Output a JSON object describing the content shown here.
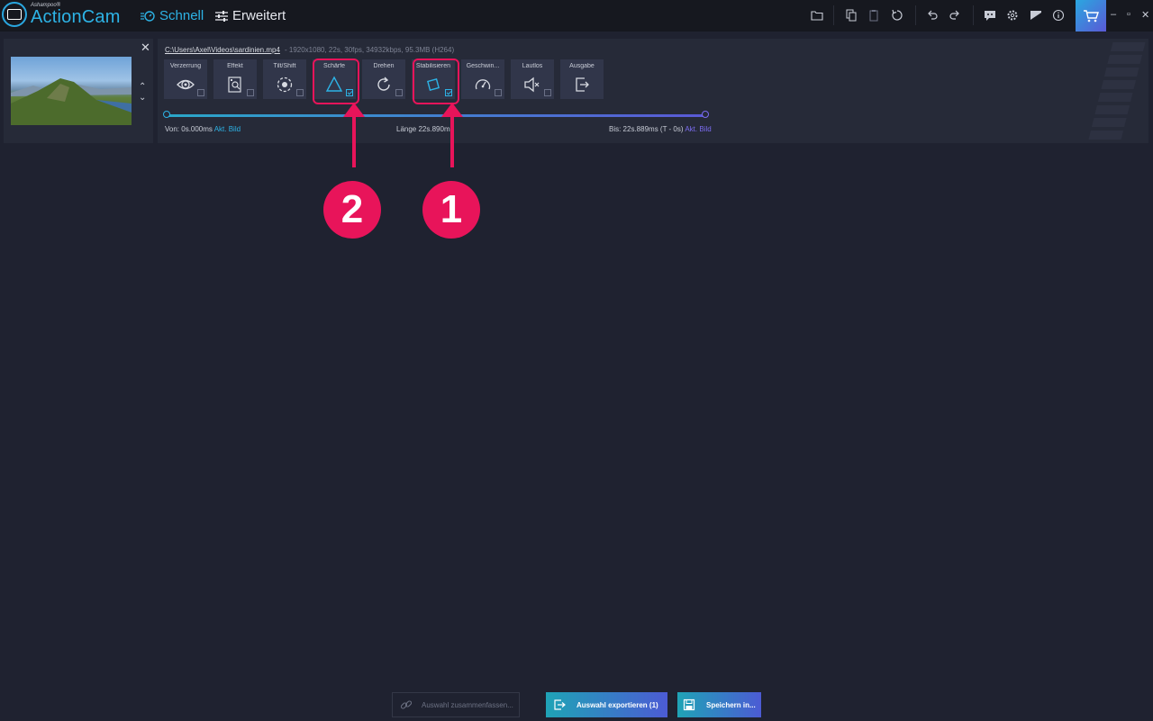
{
  "app": {
    "brand_small": "Ashampoo®",
    "brand": "ActionCam",
    "mode_quick": "Schnell",
    "mode_advanced": "Erweitert"
  },
  "toolbar_icons": [
    "folder-icon",
    "copy-icon",
    "clipboard-icon",
    "reset-icon",
    "undo-icon",
    "redo-icon",
    "feedback-icon",
    "settings-icon",
    "image-icon",
    "info-icon",
    "cart-icon"
  ],
  "window_controls": [
    "–",
    "▫",
    "✕"
  ],
  "item": {
    "file_path": "C:\\Users\\Axel\\Videos\\sardinien.mp4",
    "file_info": "-   1920x1080, 22s, 30fps, 34932kbps, 95.3MB (H264)",
    "tools": [
      {
        "label": "Verzerrung",
        "icon": "eye-icon",
        "checked": false
      },
      {
        "label": "Effekt",
        "icon": "effect-icon",
        "checked": false
      },
      {
        "label": "Tilt/Shift",
        "icon": "tiltshift-icon",
        "checked": false
      },
      {
        "label": "Schärfe",
        "icon": "sharpness-icon",
        "checked": true
      },
      {
        "label": "Drehen",
        "icon": "rotate-icon",
        "checked": false
      },
      {
        "label": "Stabilisieren",
        "icon": "stabilize-icon",
        "checked": true
      },
      {
        "label": "Geschwin...",
        "icon": "speed-icon",
        "checked": false
      },
      {
        "label": "Lautlos",
        "icon": "mute-icon",
        "checked": false
      },
      {
        "label": "Ausgabe",
        "icon": "output-icon",
        "checked": false
      }
    ],
    "timeline": {
      "from_label": "Von: 0s.000ms",
      "from_link": "Akt. Bild",
      "length_label": "Länge 22s.890ms",
      "to_label": "Bis:  22s.889ms (T - 0s)",
      "to_link": "Akt. Bild"
    }
  },
  "annotations": {
    "badge_1": "1",
    "badge_2": "2",
    "color": "#e8145a"
  },
  "bottom": {
    "merge_label": "Auswahl zusammenfassen...",
    "export_label": "Auswahl exportieren (1)",
    "save_label": "Speichern in..."
  }
}
